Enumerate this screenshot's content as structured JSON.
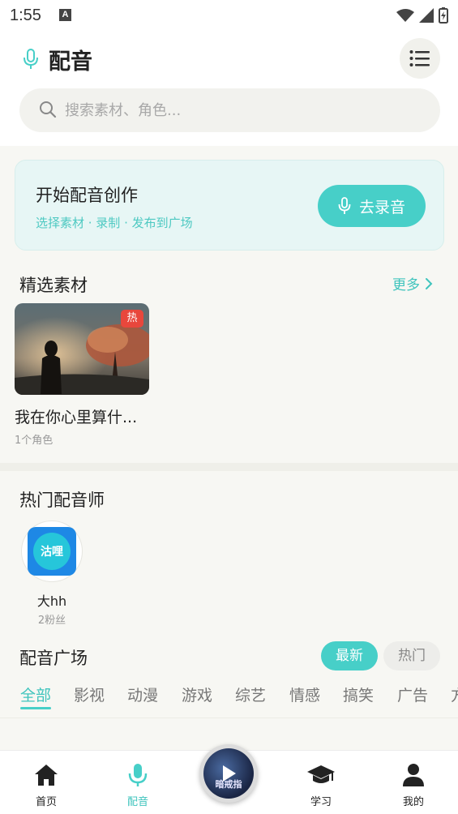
{
  "status_bar": {
    "time": "1:55",
    "notification_letter": "A"
  },
  "header": {
    "title": "配音"
  },
  "search": {
    "placeholder": "搜索素材、角色..."
  },
  "banner": {
    "title": "开始配音创作",
    "subtitle": "选择素材 · 录制 · 发布到广场",
    "button_label": "去录音"
  },
  "featured": {
    "title": "精选素材",
    "more_label": "更多",
    "items": [
      {
        "badge": "热",
        "title": "我在你心里算什...",
        "subtitle": "1个角色"
      }
    ]
  },
  "popular_dubbers": {
    "title": "热门配音师",
    "items": [
      {
        "avatar_text": "沽哩",
        "name": "大hh",
        "fans": "2粉丝"
      }
    ]
  },
  "plaza": {
    "title": "配音广场",
    "sort": {
      "latest": "最新",
      "hot": "热门",
      "selected": "最新"
    },
    "categories": [
      "全部",
      "影视",
      "动漫",
      "游戏",
      "综艺",
      "情感",
      "搞笑",
      "广告",
      "方"
    ],
    "selected_category": "全部"
  },
  "bottom_nav": {
    "items": [
      {
        "label": "首页",
        "icon": "home-icon"
      },
      {
        "label": "配音",
        "icon": "mic-icon",
        "active": true
      },
      {
        "label": "学习",
        "icon": "graduation-cap-icon"
      },
      {
        "label": "我的",
        "icon": "user-icon"
      }
    ],
    "center_disc_text": "暗戒指"
  },
  "colors": {
    "accent": "#47cfc8",
    "hot_badge": "#e8473c",
    "banner_bg": "#e7f6f5"
  }
}
